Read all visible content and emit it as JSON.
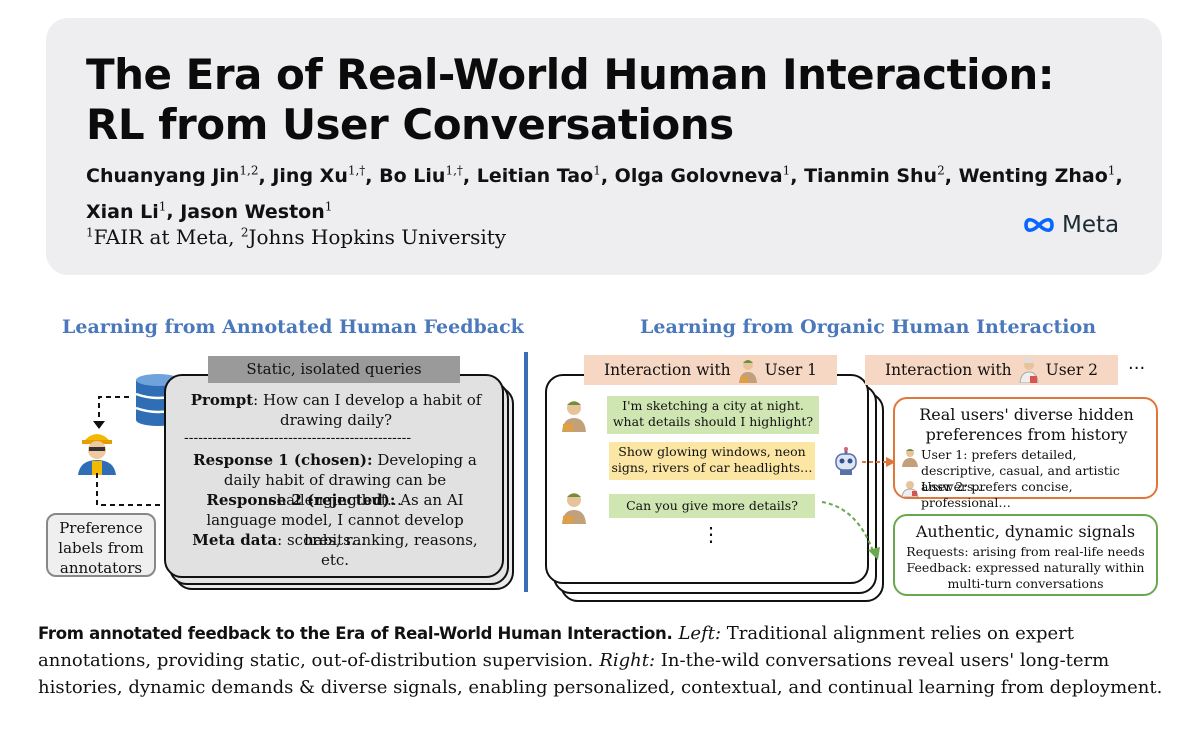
{
  "header": {
    "title_line1": "The Era of Real-World Human Interaction:",
    "title_line2": "RL from User Conversations",
    "authors": [
      {
        "name": "Chuanyang Jin",
        "sup": "1,2"
      },
      {
        "name": "Jing Xu",
        "sup": "1,†"
      },
      {
        "name": "Bo Liu",
        "sup": "1,†"
      },
      {
        "name": "Leitian Tao",
        "sup": "1"
      },
      {
        "name": "Olga Golovneva",
        "sup": "1"
      },
      {
        "name": "Tianmin Shu",
        "sup": "2"
      },
      {
        "name": "Wenting Zhao",
        "sup": "1"
      },
      {
        "name": "Xian Li",
        "sup": "1"
      },
      {
        "name": "Jason Weston",
        "sup": "1"
      }
    ],
    "affiliations": [
      {
        "sup": "1",
        "name": "FAIR at Meta"
      },
      {
        "sup": "2",
        "name": "Johns Hopkins University"
      }
    ],
    "logo_text": "Meta",
    "logo_color": "#0866ff"
  },
  "left": {
    "title": "Learning from Annotated Human Feedback",
    "tag": "Static, isolated queries",
    "prompt_label": "Prompt",
    "prompt_text": ": How can I develop a habit of drawing daily?",
    "dashes": "------------------------------------------------",
    "r1_label": "Response 1 (chosen):",
    "r1_text": " Developing a daily habit of drawing can be challenging but…",
    "r2_label": "Response 2 (rejected):",
    "r2_text": " As an AI language model, I cannot develop habits…",
    "meta_label": "Meta data",
    "meta_text": ": scores, ranking, reasons, etc.",
    "pref_box": "Preference labels from annotators"
  },
  "right": {
    "title": "Learning from Organic Human Interaction",
    "tab1_prefix": "Interaction with",
    "tab1_user": "User 1",
    "tab2_prefix": "Interaction with",
    "tab2_user": "User 2",
    "ellipsis": "···",
    "msg1": "I'm sketching a city at night. what details should I highlight?",
    "msg2": "Show glowing windows, neon signs, rivers of car headlights…",
    "msg3": "Can you give more details?",
    "vdots": "⋮",
    "pref_title": "Real users' diverse hidden preferences from history",
    "pref_user1": "User 1: prefers detailed, descriptive, casual, and artistic answers…",
    "pref_user2": "User 2: prefers concise, professional…",
    "signals_title": "Authentic, dynamic signals",
    "signals_line1": "Requests: arising from real-life needs",
    "signals_line2": "Feedback: expressed naturally within multi-turn conversations",
    "colors": {
      "section_title": "#4a78bb",
      "orange": "#e0763a",
      "green": "#6aa84f",
      "tag_peach": "#f6d7c3"
    }
  },
  "caption": {
    "bold": "From annotated feedback to the Era of Real-World Human Interaction.",
    "left_label": "Left:",
    "left_text": " Traditional alignment relies on expert annotations, providing static, out-of-distribution supervision.",
    "right_label": "Right:",
    "right_text": " In-the-wild conversations reveal users' long-term histories, dynamic demands & diverse signals, enabling personalized, contextual, and continual learning from deployment."
  }
}
